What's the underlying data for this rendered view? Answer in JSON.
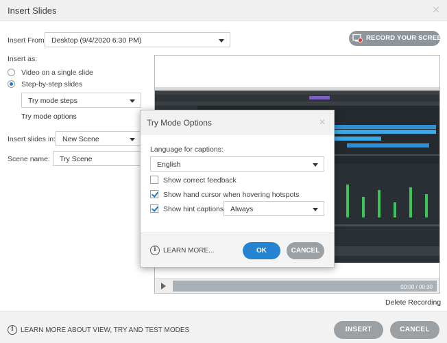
{
  "window": {
    "title": "Insert Slides",
    "close_glyph": "✕"
  },
  "insert_from": {
    "label": "Insert From:",
    "value": "Desktop (9/4/2020 6:30 PM)"
  },
  "record": {
    "label": "RECORD YOUR SCREEN",
    "icon": "record-screen-icon"
  },
  "insert_as": {
    "label": "Insert as:",
    "options": [
      {
        "label": "Video on a single slide",
        "selected": false
      },
      {
        "label": "Step-by-step slides",
        "selected": true
      }
    ],
    "mode_select": "Try mode steps",
    "mode_options_link": "Try mode options"
  },
  "insert_slides_in": {
    "label": "Insert slides in:",
    "value": "New Scene"
  },
  "scene_name": {
    "label": "Scene name:",
    "value": "Try Scene"
  },
  "preview": {
    "time": "00:00 / 00:30"
  },
  "delete_recording": "Delete Recording",
  "footer": {
    "learn_more": "LEARN MORE ABOUT VIEW, TRY AND TEST MODES",
    "insert": "INSERT",
    "cancel": "CANCEL"
  },
  "dialog": {
    "title": "Try Mode Options",
    "close_glyph": "✕",
    "language_label": "Language for captions:",
    "language_value": "English",
    "checkboxes": [
      {
        "label": "Show correct feedback",
        "checked": false
      },
      {
        "label": "Show hand cursor when hovering hotspots",
        "checked": true
      },
      {
        "label": "Show hint captions",
        "checked": true
      }
    ],
    "hint_mode": "Always",
    "learn_more": "LEARN MORE...",
    "ok": "OK",
    "cancel": "CANCEL"
  },
  "colors": {
    "accent": "#2683d0",
    "button_gray": "#9aa0a4",
    "daw_bg": "#24292d",
    "meter_green": "#3bc45a"
  }
}
